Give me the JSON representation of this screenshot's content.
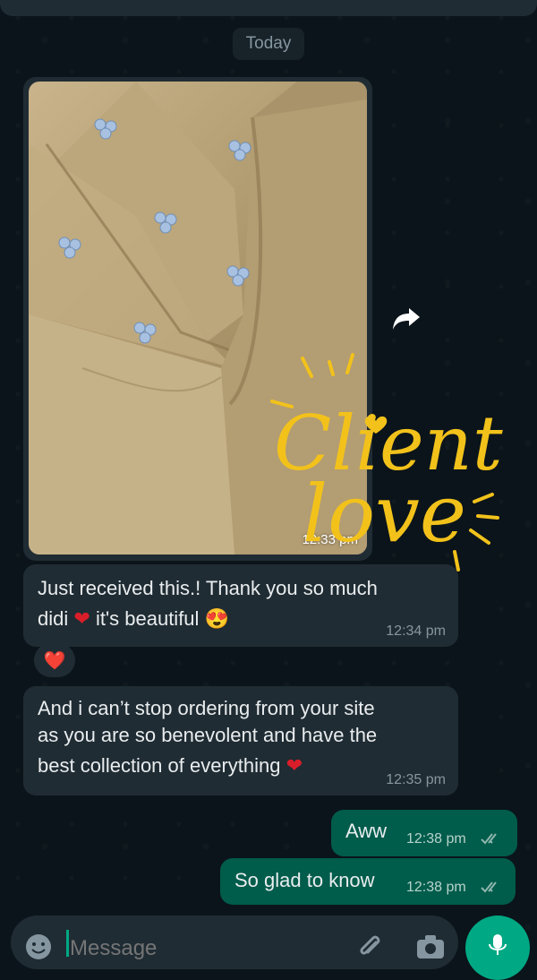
{
  "chat": {
    "date_divider": "Today",
    "image_message": {
      "time": "12:33 pm"
    },
    "sticker_text": [
      "Client",
      "love"
    ],
    "messages_in": [
      {
        "line1": "Just received this.! Thank you so much",
        "line2_a": "didi",
        "line2_b": "it's beautiful",
        "time": "12:34 pm",
        "reaction": "❤️"
      },
      {
        "line1": "And i can’t stop ordering from your site",
        "line2": "as you are so benevolent and have the",
        "line3": "best collection of everything",
        "time": "12:35 pm"
      }
    ],
    "messages_out": [
      {
        "text": "Aww",
        "time": "12:38 pm",
        "status": "read"
      },
      {
        "text": "So glad to know",
        "time": "12:38 pm",
        "status": "read"
      }
    ]
  },
  "composer": {
    "placeholder": "Message"
  },
  "colors": {
    "background": "#0b141a",
    "incoming_bubble": "#202c33",
    "outgoing_bubble": "#005c4b",
    "accent": "#00a884",
    "read_ticks": "#8fb6ad"
  },
  "icons": [
    "forward-icon",
    "emoji-icon",
    "attach-icon",
    "camera-icon",
    "mic-icon",
    "double-check-icon"
  ]
}
